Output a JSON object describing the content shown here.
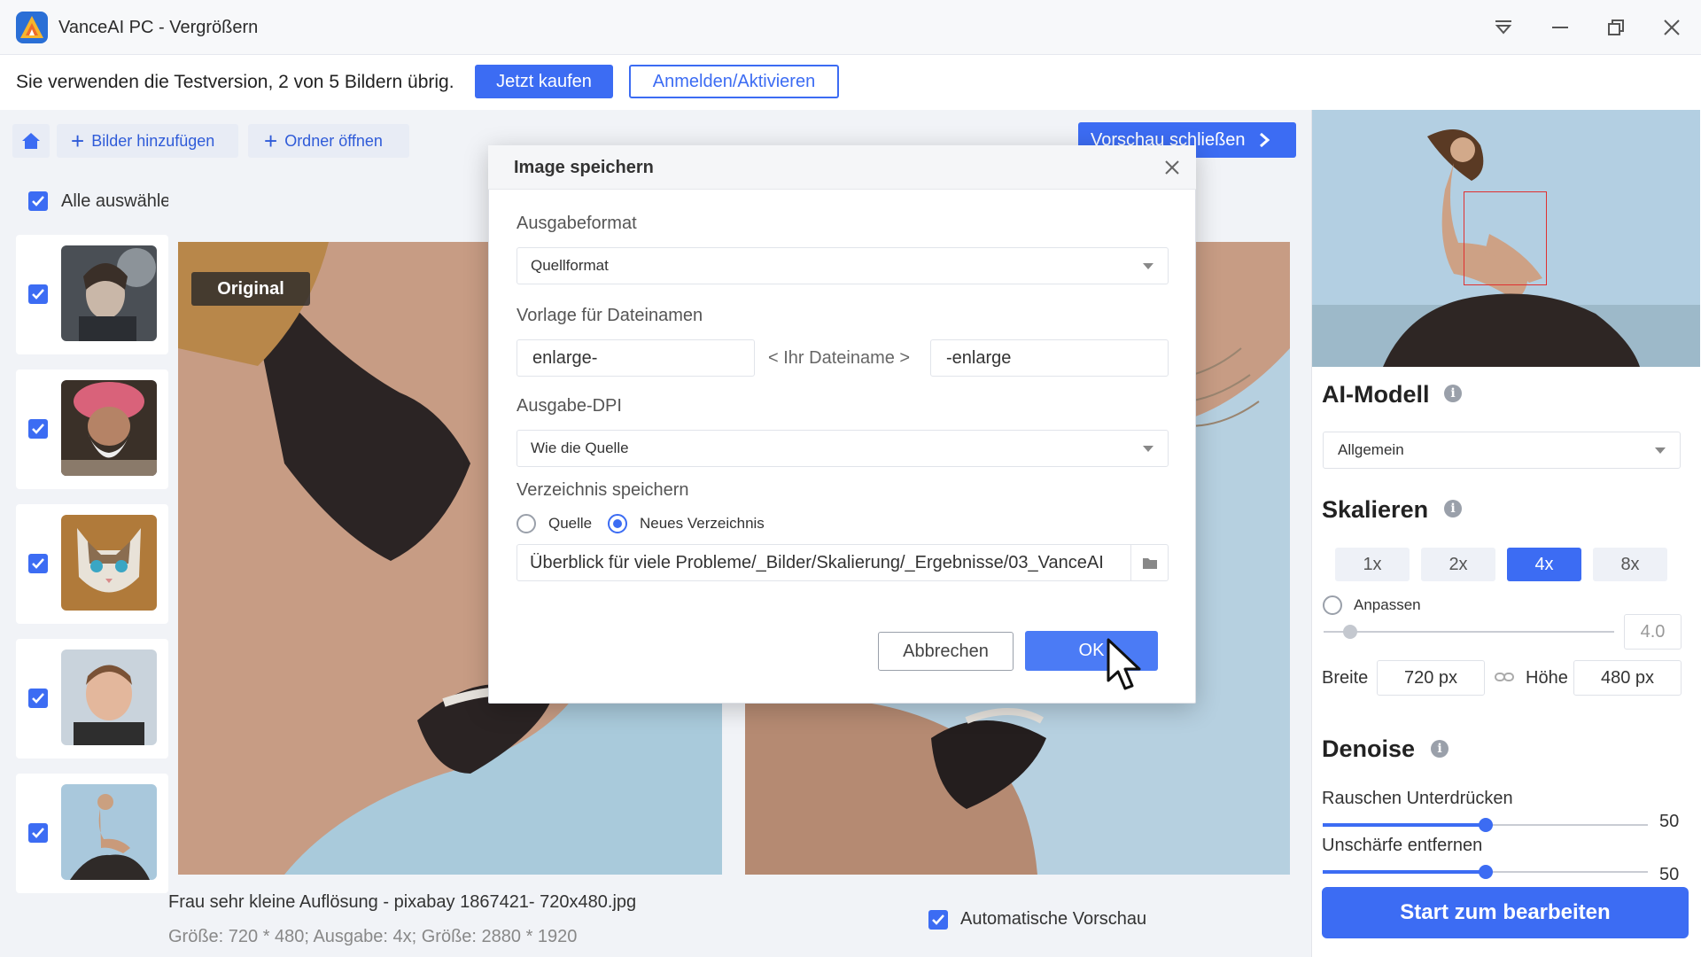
{
  "window": {
    "title": "VanceAI PC - Vergrößern"
  },
  "trial": {
    "text": "Sie verwenden die Testversion, 2 von 5 Bildern übrig.",
    "buy_label": "Jetzt kaufen",
    "login_label": "Anmelden/Aktivieren"
  },
  "toolbar": {
    "add_images_label": "Bilder hinzufügen",
    "open_folder_label": "Ordner öffnen",
    "close_preview_label": "Vorschau schließen"
  },
  "sidebar": {
    "select_all_label": "Alle auswähle",
    "items": [
      {
        "name": "cyborg-woman",
        "checked": true
      },
      {
        "name": "old-man-turban",
        "checked": true
      },
      {
        "name": "cat",
        "checked": true
      },
      {
        "name": "boy",
        "checked": true
      },
      {
        "name": "woman-on-rock",
        "checked": true
      }
    ]
  },
  "preview": {
    "original_label": "Original",
    "file_name": "Frau sehr kleine Auflösung - pixabay 1867421- 720x480.jpg",
    "file_info": "Größe: 720 * 480; Ausgabe: 4x; Größe: 2880 * 1920",
    "auto_preview_label": "Automatische Vorschau"
  },
  "right_panel": {
    "ai_model_title": "AI-Modell",
    "ai_model_value": "Allgemein",
    "scale_title": "Skalieren",
    "scale_options": [
      "1x",
      "2x",
      "4x",
      "8x"
    ],
    "scale_selected": "4x",
    "custom_label": "Anpassen",
    "custom_value": "4.0",
    "width_label": "Breite",
    "width_value": "720 px",
    "height_label": "Höhe",
    "height_value": "480 px",
    "denoise_title": "Denoise",
    "noise_label": "Rauschen Unterdrücken",
    "noise_value": "50",
    "blur_label": "Unschärfe entfernen",
    "blur_value": "50",
    "start_label": "Start zum bearbeiten"
  },
  "dialog": {
    "title": "Image speichern",
    "format_label": "Ausgabeformat",
    "format_value": "Quellformat",
    "filename_label": "Vorlage für Dateinamen",
    "prefix_value": "enlarge-",
    "filename_middle": "< Ihr Dateiname >",
    "suffix_value": "-enlarge",
    "dpi_label": "Ausgabe-DPI",
    "dpi_value": "Wie die Quelle",
    "dir_label": "Verzeichnis speichern",
    "radio_source_label": "Quelle",
    "radio_new_label": "Neues Verzeichnis",
    "radio_selected": "Neues Verzeichnis",
    "path_value": "Überblick für viele Probleme/_Bilder/Skalierung/_Ergebnisse/03_VanceAI",
    "cancel_label": "Abbrechen",
    "ok_label": "OK"
  },
  "colors": {
    "accent": "#3c6cf3",
    "background": "#f1f3f7"
  }
}
